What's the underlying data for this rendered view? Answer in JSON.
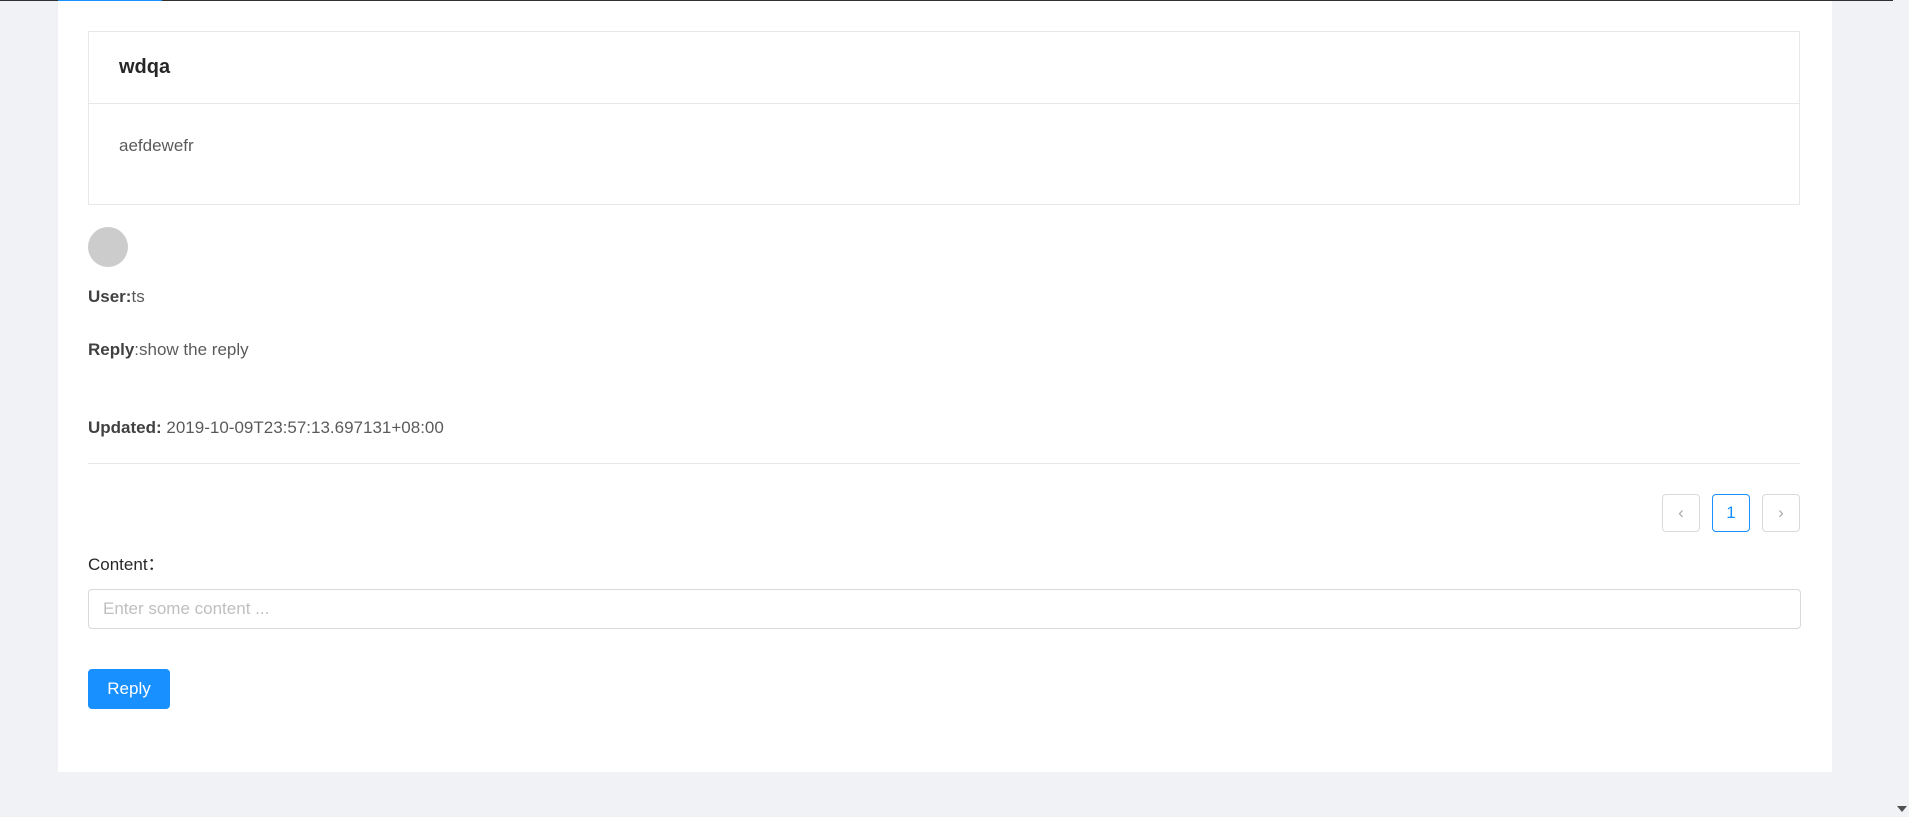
{
  "post": {
    "title": "wdqa",
    "body": "aefdewefr"
  },
  "reply_item": {
    "user_label": "User:",
    "user_value": "ts",
    "reply_label": "Reply",
    "reply_value": ":show the reply",
    "updated_label": "Updated:",
    "updated_value": " 2019-10-09T23:57:13.697131+08:00"
  },
  "pagination": {
    "prev_icon": "‹",
    "current_page": "1",
    "next_icon": "›"
  },
  "form": {
    "content_label": "Content：",
    "content_placeholder": "Enter some content ...",
    "content_value": "",
    "submit_label": "Reply"
  },
  "colors": {
    "accent": "#1890ff",
    "page_background": "#f0f2f5",
    "card_background": "#ffffff",
    "avatar_placeholder": "#cccccc"
  },
  "icons": {
    "prev": "chevron-left-icon",
    "next": "chevron-right-icon",
    "scroll_down": "scroll-down-arrow-icon"
  }
}
